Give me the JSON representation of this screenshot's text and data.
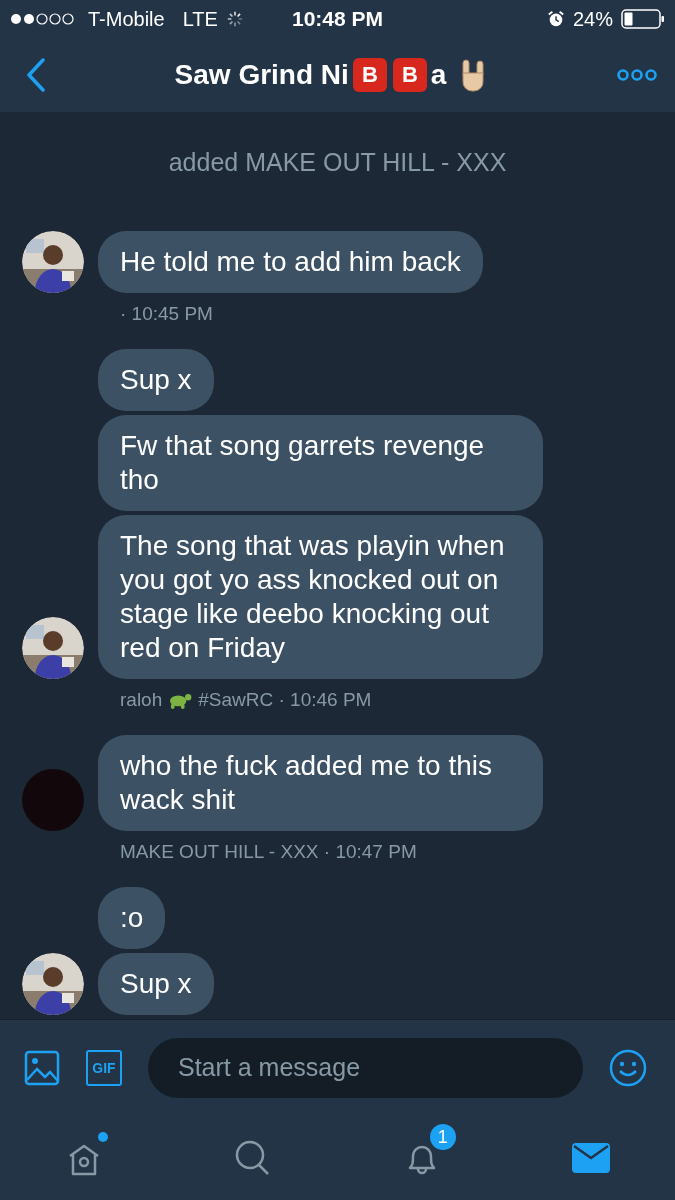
{
  "status_bar": {
    "carrier": "T-Mobile",
    "network": "LTE",
    "time": "10:48 PM",
    "battery": "24%"
  },
  "header": {
    "title_parts": [
      {
        "kind": "text",
        "text": "Saw Grind Ni"
      },
      {
        "kind": "letter_emoji",
        "text": "B"
      },
      {
        "kind": "letter_emoji",
        "text": "B"
      },
      {
        "kind": "text",
        "text": "a"
      },
      {
        "kind": "hand_emoji"
      }
    ]
  },
  "thread": [
    {
      "kind": "system",
      "text": "added MAKE OUT HILL - XXX"
    },
    {
      "kind": "group",
      "avatar": {
        "kind": "picture"
      },
      "messages": [
        "He told me to add him back"
      ],
      "meta": [
        {
          "kind": "text",
          "text": "· 10:45 PM"
        }
      ]
    },
    {
      "kind": "group",
      "avatar": {
        "kind": "picture"
      },
      "messages": [
        "Sup x",
        "Fw that song garrets revenge tho",
        "The song that was playin when you got yo ass knocked out on stage like deebo knocking out red on Friday"
      ],
      "meta": [
        {
          "kind": "text",
          "text": "raloh"
        },
        {
          "kind": "turtle_emoji"
        },
        {
          "kind": "text",
          "text": "#SawRC · 10:46 PM"
        }
      ]
    },
    {
      "kind": "group",
      "avatar": {
        "kind": "blank"
      },
      "messages": [
        "who the fuck added me to this wack shit"
      ],
      "meta": [
        {
          "kind": "text",
          "text": "MAKE OUT HILL - XXX · 10:47 PM"
        }
      ]
    },
    {
      "kind": "group",
      "avatar": {
        "kind": "picture"
      },
      "messages": [
        ":o",
        "Sup x"
      ]
    }
  ],
  "composer": {
    "placeholder": "Start a message",
    "gif_label": "GIF"
  },
  "tab_bar": [
    {
      "kind": "home",
      "selected": false,
      "dot": true
    },
    {
      "kind": "search",
      "selected": false
    },
    {
      "kind": "notifications",
      "selected": false,
      "badge": "1"
    },
    {
      "kind": "messages",
      "selected": true
    }
  ]
}
